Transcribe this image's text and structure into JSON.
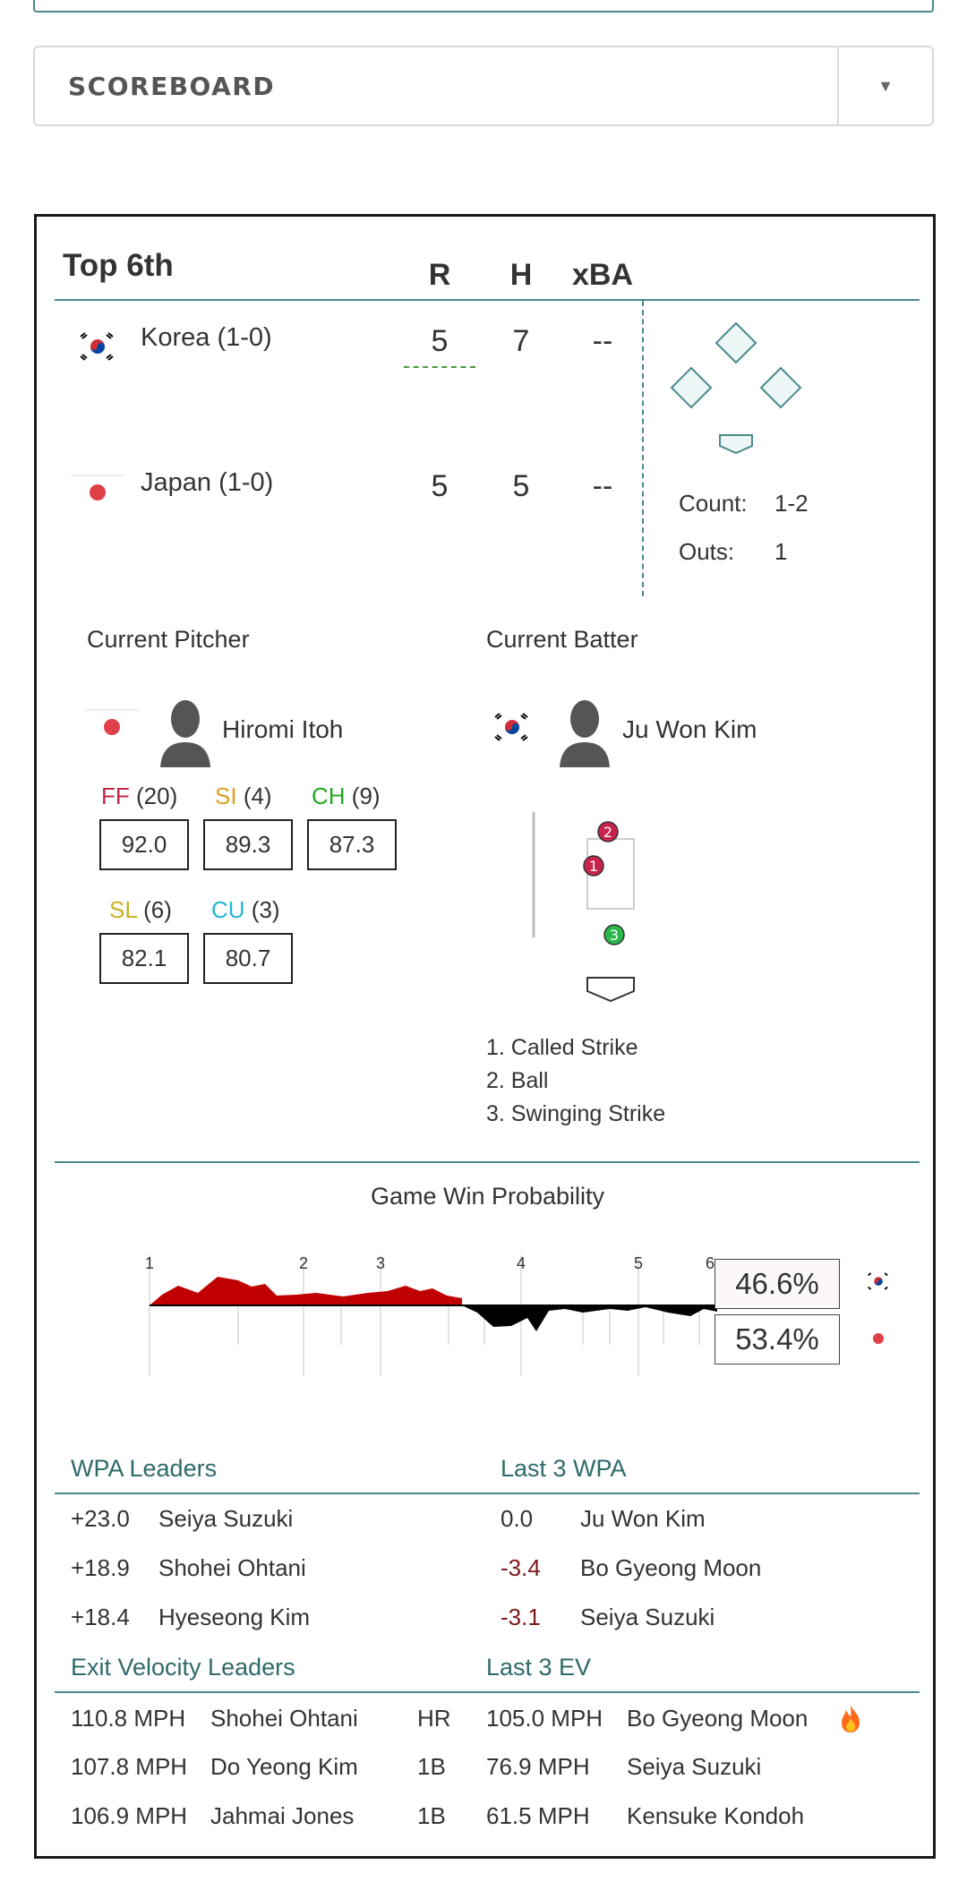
{
  "selector": {
    "label": "SCOREBOARD",
    "arrow": "▼"
  },
  "scoreboard": {
    "inning": "Top 6th",
    "columns": [
      "R",
      "H",
      "xBA"
    ],
    "teams": [
      {
        "name": "Korea (1-0)",
        "flag": "korea-flag-icon",
        "r": "5",
        "h": "7",
        "xba": "--"
      },
      {
        "name": "Japan (1-0)",
        "flag": "japan-flag-icon",
        "r": "5",
        "h": "5",
        "xba": "--"
      }
    ],
    "count_label": "Count:",
    "count_value": "1-2",
    "outs_label": "Outs:",
    "outs_value": "1"
  },
  "pitcher": {
    "title": "Current Pitcher",
    "name": "Hiromi Itoh",
    "pitches": [
      {
        "code": "FF",
        "count": "(20)",
        "velo": "92.0",
        "color": "#c0264a"
      },
      {
        "code": "SI",
        "count": "(4)",
        "velo": "89.3",
        "color": "#e0a020"
      },
      {
        "code": "CH",
        "count": "(9)",
        "velo": "87.3",
        "color": "#22aa22"
      },
      {
        "code": "SL",
        "count": "(6)",
        "velo": "82.1",
        "color": "#c8b020"
      },
      {
        "code": "CU",
        "count": "(3)",
        "velo": "80.7",
        "color": "#22b8d8"
      }
    ]
  },
  "batter": {
    "title": "Current Batter",
    "name": "Ju Won Kim",
    "pitch_results": [
      "1. Called Strike",
      "2. Ball",
      "3. Swinging Strike"
    ],
    "pitch_markers": [
      "1",
      "2",
      "3"
    ]
  },
  "win_probability": {
    "title": "Game Win Probability",
    "inning_marks": [
      "1",
      "2",
      "3",
      "4",
      "5",
      "6"
    ],
    "korea": "46.6%",
    "japan": "53.4%",
    "colors": {
      "korea_area": "#c00000",
      "japan_area": "#000000"
    }
  },
  "wpa_leaders": {
    "title": "WPA Leaders",
    "rows": [
      {
        "value": "+23.0",
        "name": "Seiya Suzuki"
      },
      {
        "value": "+18.9",
        "name": "Shohei Ohtani"
      },
      {
        "value": "+18.4",
        "name": "Hyeseong Kim"
      }
    ]
  },
  "last3_wpa": {
    "title": "Last 3 WPA",
    "rows": [
      {
        "value": "0.0",
        "name": "Ju Won Kim"
      },
      {
        "value": "-3.4",
        "name": "Bo Gyeong Moon"
      },
      {
        "value": "-3.1",
        "name": "Seiya Suzuki"
      }
    ]
  },
  "ev_leaders": {
    "title": "Exit Velocity Leaders",
    "rows": [
      {
        "value": "110.8 MPH",
        "name": "Shohei Ohtani",
        "result": "HR"
      },
      {
        "value": "107.8 MPH",
        "name": "Do Yeong Kim",
        "result": "1B"
      },
      {
        "value": "106.9 MPH",
        "name": "Jahmai Jones",
        "result": "1B"
      }
    ]
  },
  "last3_ev": {
    "title": "Last 3 EV",
    "rows": [
      {
        "value": "105.0 MPH",
        "name": "Bo Gyeong Moon",
        "icon": "fire-icon"
      },
      {
        "value": "76.9 MPH",
        "name": "Seiya Suzuki"
      },
      {
        "value": "61.5 MPH",
        "name": "Kensuke Kondoh"
      }
    ]
  },
  "accent_color": "#4a8a8a"
}
